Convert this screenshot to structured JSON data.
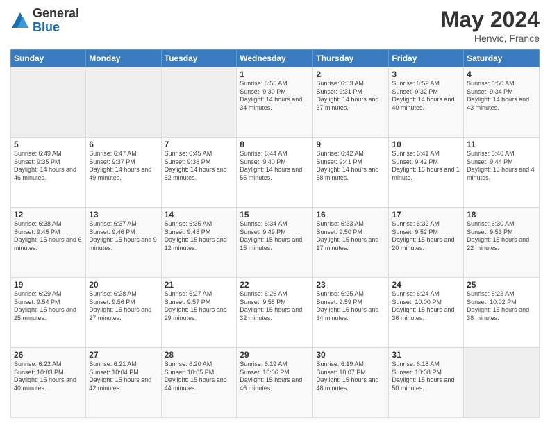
{
  "header": {
    "logo_general": "General",
    "logo_blue": "Blue",
    "month_year": "May 2024",
    "location": "Henvic, France"
  },
  "days_of_week": [
    "Sunday",
    "Monday",
    "Tuesday",
    "Wednesday",
    "Thursday",
    "Friday",
    "Saturday"
  ],
  "weeks": [
    [
      {
        "day": "",
        "sunrise": "",
        "sunset": "",
        "daylight": ""
      },
      {
        "day": "",
        "sunrise": "",
        "sunset": "",
        "daylight": ""
      },
      {
        "day": "",
        "sunrise": "",
        "sunset": "",
        "daylight": ""
      },
      {
        "day": "1",
        "sunrise": "Sunrise: 6:55 AM",
        "sunset": "Sunset: 9:30 PM",
        "daylight": "Daylight: 14 hours and 34 minutes."
      },
      {
        "day": "2",
        "sunrise": "Sunrise: 6:53 AM",
        "sunset": "Sunset: 9:31 PM",
        "daylight": "Daylight: 14 hours and 37 minutes."
      },
      {
        "day": "3",
        "sunrise": "Sunrise: 6:52 AM",
        "sunset": "Sunset: 9:32 PM",
        "daylight": "Daylight: 14 hours and 40 minutes."
      },
      {
        "day": "4",
        "sunrise": "Sunrise: 6:50 AM",
        "sunset": "Sunset: 9:34 PM",
        "daylight": "Daylight: 14 hours and 43 minutes."
      }
    ],
    [
      {
        "day": "5",
        "sunrise": "Sunrise: 6:49 AM",
        "sunset": "Sunset: 9:35 PM",
        "daylight": "Daylight: 14 hours and 46 minutes."
      },
      {
        "day": "6",
        "sunrise": "Sunrise: 6:47 AM",
        "sunset": "Sunset: 9:37 PM",
        "daylight": "Daylight: 14 hours and 49 minutes."
      },
      {
        "day": "7",
        "sunrise": "Sunrise: 6:45 AM",
        "sunset": "Sunset: 9:38 PM",
        "daylight": "Daylight: 14 hours and 52 minutes."
      },
      {
        "day": "8",
        "sunrise": "Sunrise: 6:44 AM",
        "sunset": "Sunset: 9:40 PM",
        "daylight": "Daylight: 14 hours and 55 minutes."
      },
      {
        "day": "9",
        "sunrise": "Sunrise: 6:42 AM",
        "sunset": "Sunset: 9:41 PM",
        "daylight": "Daylight: 14 hours and 58 minutes."
      },
      {
        "day": "10",
        "sunrise": "Sunrise: 6:41 AM",
        "sunset": "Sunset: 9:42 PM",
        "daylight": "Daylight: 15 hours and 1 minute."
      },
      {
        "day": "11",
        "sunrise": "Sunrise: 6:40 AM",
        "sunset": "Sunset: 9:44 PM",
        "daylight": "Daylight: 15 hours and 4 minutes."
      }
    ],
    [
      {
        "day": "12",
        "sunrise": "Sunrise: 6:38 AM",
        "sunset": "Sunset: 9:45 PM",
        "daylight": "Daylight: 15 hours and 6 minutes."
      },
      {
        "day": "13",
        "sunrise": "Sunrise: 6:37 AM",
        "sunset": "Sunset: 9:46 PM",
        "daylight": "Daylight: 15 hours and 9 minutes."
      },
      {
        "day": "14",
        "sunrise": "Sunrise: 6:35 AM",
        "sunset": "Sunset: 9:48 PM",
        "daylight": "Daylight: 15 hours and 12 minutes."
      },
      {
        "day": "15",
        "sunrise": "Sunrise: 6:34 AM",
        "sunset": "Sunset: 9:49 PM",
        "daylight": "Daylight: 15 hours and 15 minutes."
      },
      {
        "day": "16",
        "sunrise": "Sunrise: 6:33 AM",
        "sunset": "Sunset: 9:50 PM",
        "daylight": "Daylight: 15 hours and 17 minutes."
      },
      {
        "day": "17",
        "sunrise": "Sunrise: 6:32 AM",
        "sunset": "Sunset: 9:52 PM",
        "daylight": "Daylight: 15 hours and 20 minutes."
      },
      {
        "day": "18",
        "sunrise": "Sunrise: 6:30 AM",
        "sunset": "Sunset: 9:53 PM",
        "daylight": "Daylight: 15 hours and 22 minutes."
      }
    ],
    [
      {
        "day": "19",
        "sunrise": "Sunrise: 6:29 AM",
        "sunset": "Sunset: 9:54 PM",
        "daylight": "Daylight: 15 hours and 25 minutes."
      },
      {
        "day": "20",
        "sunrise": "Sunrise: 6:28 AM",
        "sunset": "Sunset: 9:56 PM",
        "daylight": "Daylight: 15 hours and 27 minutes."
      },
      {
        "day": "21",
        "sunrise": "Sunrise: 6:27 AM",
        "sunset": "Sunset: 9:57 PM",
        "daylight": "Daylight: 15 hours and 29 minutes."
      },
      {
        "day": "22",
        "sunrise": "Sunrise: 6:26 AM",
        "sunset": "Sunset: 9:58 PM",
        "daylight": "Daylight: 15 hours and 32 minutes."
      },
      {
        "day": "23",
        "sunrise": "Sunrise: 6:25 AM",
        "sunset": "Sunset: 9:59 PM",
        "daylight": "Daylight: 15 hours and 34 minutes."
      },
      {
        "day": "24",
        "sunrise": "Sunrise: 6:24 AM",
        "sunset": "Sunset: 10:00 PM",
        "daylight": "Daylight: 15 hours and 36 minutes."
      },
      {
        "day": "25",
        "sunrise": "Sunrise: 6:23 AM",
        "sunset": "Sunset: 10:02 PM",
        "daylight": "Daylight: 15 hours and 38 minutes."
      }
    ],
    [
      {
        "day": "26",
        "sunrise": "Sunrise: 6:22 AM",
        "sunset": "Sunset: 10:03 PM",
        "daylight": "Daylight: 15 hours and 40 minutes."
      },
      {
        "day": "27",
        "sunrise": "Sunrise: 6:21 AM",
        "sunset": "Sunset: 10:04 PM",
        "daylight": "Daylight: 15 hours and 42 minutes."
      },
      {
        "day": "28",
        "sunrise": "Sunrise: 6:20 AM",
        "sunset": "Sunset: 10:05 PM",
        "daylight": "Daylight: 15 hours and 44 minutes."
      },
      {
        "day": "29",
        "sunrise": "Sunrise: 6:19 AM",
        "sunset": "Sunset: 10:06 PM",
        "daylight": "Daylight: 15 hours and 46 minutes."
      },
      {
        "day": "30",
        "sunrise": "Sunrise: 6:19 AM",
        "sunset": "Sunset: 10:07 PM",
        "daylight": "Daylight: 15 hours and 48 minutes."
      },
      {
        "day": "31",
        "sunrise": "Sunrise: 6:18 AM",
        "sunset": "Sunset: 10:08 PM",
        "daylight": "Daylight: 15 hours and 50 minutes."
      },
      {
        "day": "",
        "sunrise": "",
        "sunset": "",
        "daylight": ""
      }
    ]
  ]
}
